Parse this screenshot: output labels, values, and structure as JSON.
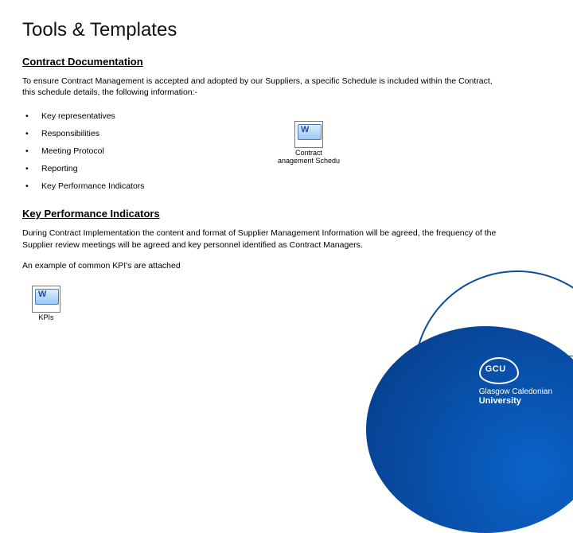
{
  "title": "Tools & Templates",
  "section1": {
    "heading": "Contract Documentation",
    "intro": "To ensure Contract Management is accepted and adopted by our Suppliers, a specific Schedule is included within the Contract, this schedule details, the following information:-",
    "bullets": [
      "Key representatives",
      "Responsibilities",
      "Meeting Protocol",
      "Reporting",
      "Key Performance Indicators"
    ],
    "embed_caption_line1": "Contract",
    "embed_caption_line2": "anagement Schedu"
  },
  "section2": {
    "heading": "Key Performance Indicators",
    "p1": "During Contract Implementation the content and format of Supplier Management Information will be agreed, the frequency of the Supplier review meetings will be agreed and key personnel identified as Contract Managers.",
    "p2": "An example of common KPI's are attached",
    "embed_caption": "KPIs"
  },
  "logo": {
    "mark": "GCU",
    "line1": "Glasgow Caledonian",
    "line2": "University"
  }
}
